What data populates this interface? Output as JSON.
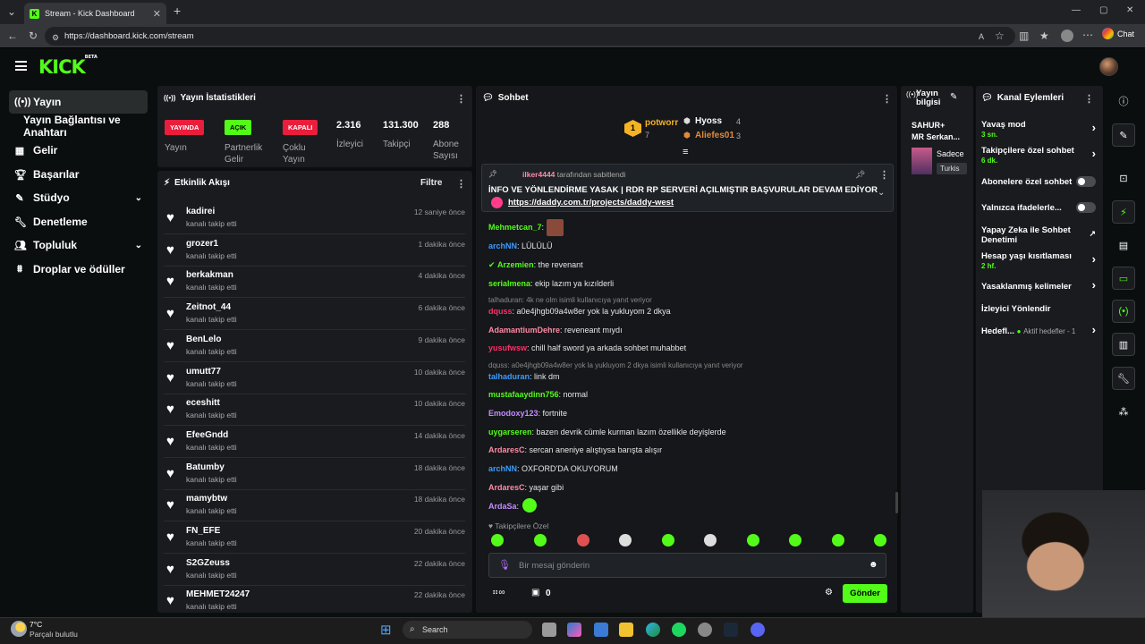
{
  "browser": {
    "tab_title": "Stream - Kick Dashboard",
    "url": "https://dashboard.kick.com/stream",
    "chat_label": "Chat"
  },
  "header": {
    "logo": "KICK",
    "logo_badge": "BETA"
  },
  "nav": {
    "items": [
      {
        "label": "Yayın",
        "icon": "broadcast-icon"
      },
      {
        "label": "Yayın Bağlantısı ve Anahtarı",
        "icon": ""
      },
      {
        "label": "Gelir",
        "icon": "revenue-icon"
      },
      {
        "label": "Başarılar",
        "icon": "trophy-icon"
      },
      {
        "label": "Stüdyo",
        "icon": "studio-icon"
      },
      {
        "label": "Denetleme",
        "icon": "moderation-icon"
      },
      {
        "label": "Topluluk",
        "icon": "community-icon"
      },
      {
        "label": "Droplar ve ödüller",
        "icon": "drops-icon"
      }
    ]
  },
  "stats": {
    "title": "Yayın İstatistikleri",
    "yayin_badge": "YAYINDA",
    "yayin_label": "Yayın",
    "partner_badge": "AÇIK",
    "partner_label_1": "Partnerlik",
    "partner_label_2": "Gelir",
    "multi_badge": "KAPALI",
    "multi_label_1": "Çoklu",
    "multi_label_2": "Yayın",
    "viewers": "2.316",
    "viewers_label": "İzleyici",
    "followers": "131.300",
    "followers_label": "Takipçi",
    "subs": "288",
    "subs_label_1": "Abone",
    "subs_label_2": "Sayısı"
  },
  "activity": {
    "title": "Etkinlik Akışı",
    "filter": "Filtre",
    "events": [
      {
        "name": "kadirei",
        "action": "kanalı takip etti",
        "time": "12 saniye önce"
      },
      {
        "name": "grozer1",
        "action": "kanalı takip etti",
        "time": "1 dakika önce"
      },
      {
        "name": "berkakman",
        "action": "kanalı takip etti",
        "time": "4 dakika önce"
      },
      {
        "name": "Zeitnot_44",
        "action": "kanalı takip etti",
        "time": "6 dakika önce"
      },
      {
        "name": "BenLelo",
        "action": "kanalı takip etti",
        "time": "9 dakika önce"
      },
      {
        "name": "umutt77",
        "action": "kanalı takip etti",
        "time": "10 dakika önce"
      },
      {
        "name": "eceshitt",
        "action": "kanalı takip etti",
        "time": "10 dakika önce"
      },
      {
        "name": "EfeeGndd",
        "action": "kanalı takip etti",
        "time": "14 dakika önce"
      },
      {
        "name": "Batumby",
        "action": "kanalı takip etti",
        "time": "18 dakika önce"
      },
      {
        "name": "mamybtw",
        "action": "kanalı takip etti",
        "time": "18 dakika önce"
      },
      {
        "name": "FN_EFE",
        "action": "kanalı takip etti",
        "time": "20 dakika önce"
      },
      {
        "name": "S2GZeuss",
        "action": "kanalı takip etti",
        "time": "22 dakika önce"
      },
      {
        "name": "MEHMET24247",
        "action": "kanalı takip etti",
        "time": "22 dakika önce"
      }
    ]
  },
  "chat": {
    "title": "Sohbet",
    "leaderboard": {
      "top_name": "potworr",
      "top_count": "7",
      "top_rank": "1",
      "second_name": "Hyoss",
      "second_count": "4",
      "third_name": "Aliefes01",
      "third_count": "3"
    },
    "pinned": {
      "by_user": "ilker4444",
      "by_text": "tarafından sabitlendi",
      "text": "İNFO VE YÖNLENDİRME YASAK | RDR RP SERVERİ AÇILMIŞTIR BAŞVURULAR DEVAM EDİYOR",
      "link": "https://daddy.com.tr/projects/daddy-west"
    },
    "messages": [
      {
        "user": "Mehmetcan_7",
        "text": "",
        "color": "#53fc18"
      },
      {
        "user": "archNN",
        "text": "LÜLÜLÜ",
        "color": "#3b9cff"
      },
      {
        "user": "Arzemien",
        "text": "the revenant",
        "color": "#53fc18"
      },
      {
        "user": "serialmena",
        "text": "ekip lazım ya kızılderli",
        "color": "#53fc18"
      },
      {
        "user": "dquss",
        "text": "a0e4jhgb09a4w8er yok la yukluyom 2 dkya",
        "color": "#ff2e6a"
      },
      {
        "user": "AdamantiumDehre",
        "text": "reveneant mıydı",
        "color": "#ff8aa6"
      },
      {
        "user": "yusufwsw",
        "text": "chill half sword ya arkada sohbet muhabbet",
        "color": "#ff2e6a"
      },
      {
        "user": "talhaduran",
        "text": "link dm",
        "color": "#3b9cff"
      },
      {
        "user": "mustafaaydinn756",
        "text": "normal",
        "color": "#53fc18"
      },
      {
        "user": "Emodoxy123",
        "text": "fortnite",
        "color": "#c48cff"
      },
      {
        "user": "uygarseren",
        "text": "bazen devrik cümle kurman lazım özellikle deyişlerde",
        "color": "#53fc18"
      },
      {
        "user": "ArdaresC",
        "text": "sercan aneniye alıştıysa barışta alışır",
        "color": "#ff8aa6"
      },
      {
        "user": "archNN",
        "text": "OXFORD'DA OKUYORUM",
        "color": "#3b9cff"
      },
      {
        "user": "ArdaresC",
        "text": "yaşar gibi",
        "color": "#ff8aa6"
      },
      {
        "user": "ArdaSa",
        "text": "",
        "color": "#c48cff"
      }
    ],
    "reply1": "talhaduran: 4k ne olm isimli kullanıcıya yanıt veriyor",
    "reply2": "dquss: a0e4jhgb09a4w8er yok la yukluyom 2 dkya isimli kullanıcıya yanıt veriyor",
    "followers_only": "Takipçilere Özel",
    "input_placeholder": "Bir mesaj gönderin",
    "points": "0",
    "send": "Gönder"
  },
  "stream_info": {
    "title_1": "Yayın",
    "title_2": "bilgisi",
    "line1": "SAHUR+",
    "line2": "MR Serkan...",
    "cat": "Sadece",
    "lang": "Turkis"
  },
  "channel_actions": {
    "title": "Kanal Eylemleri",
    "items": [
      {
        "label": "Yavaş mod",
        "sub": "3 sn."
      },
      {
        "label": "Takipçilere özel sohbet",
        "sub": "6 dk."
      },
      {
        "label": "Abonelere özel sohbet",
        "sub": ""
      },
      {
        "label": "Yalnızca ifadelerle...",
        "sub": ""
      },
      {
        "label": "Yapay Zeka ile Sohbet Denetimi",
        "sub": ""
      },
      {
        "label": "Hesap yaşı kısıtlaması",
        "sub": "2 hf."
      },
      {
        "label": "Yasaklanmış kelimeler",
        "sub": ""
      },
      {
        "label": "İzleyici Yönlendir",
        "sub": ""
      },
      {
        "label": "Hedefl...",
        "sub": "Aktif hedefler - 1"
      }
    ]
  },
  "taskbar": {
    "temp": "7°C",
    "weather": "Parçalı bulutlu",
    "search": "Search"
  },
  "colors": {
    "accent": "#53fc18",
    "live": "#e91e3c",
    "panel": "#191b1f"
  }
}
